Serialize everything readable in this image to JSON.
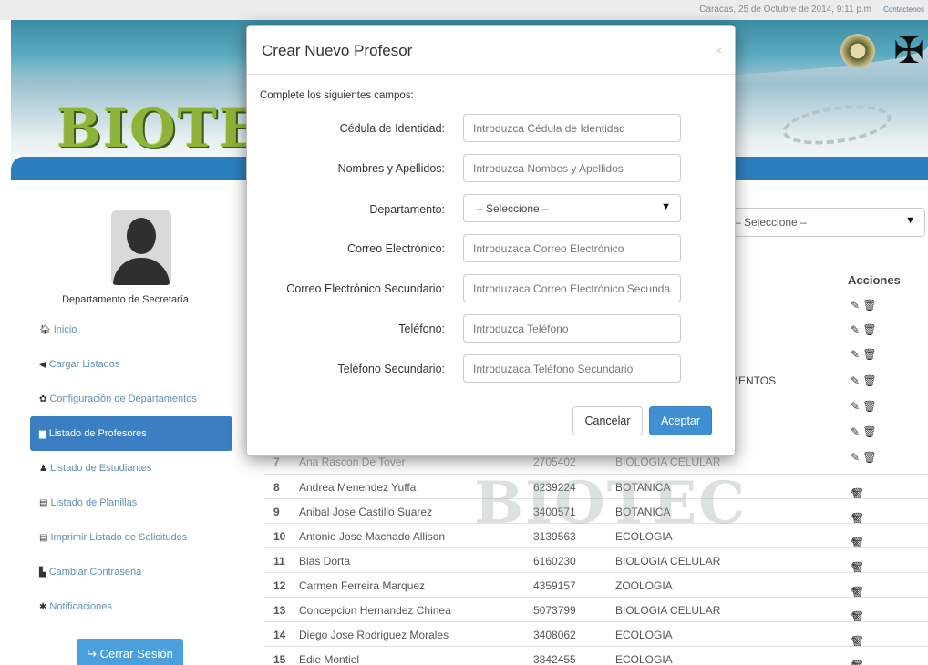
{
  "topbar": {
    "date": "Caracas, 25 de Octubre de 2014, 9:11 p.m",
    "contact": "Contactenos"
  },
  "banner": {
    "logo": "BIOTEC"
  },
  "sidebar": {
    "dept": "Departamento de Secretaría",
    "items": [
      {
        "label": "Inicio",
        "icon": "home-icon",
        "glyph": "🏠︎"
      },
      {
        "label": "Cargar Listados",
        "icon": "upload-icon",
        "glyph": "◀"
      },
      {
        "label": "Configuración de Departamentos",
        "icon": "gear-icon",
        "glyph": "✿"
      },
      {
        "label": "Listado de Profesores",
        "icon": "list-icon",
        "glyph": "▆"
      },
      {
        "label": "Listado de Estudiantes",
        "icon": "user-icon",
        "glyph": "♟"
      },
      {
        "label": "Listado de Planillas",
        "icon": "table-icon",
        "glyph": "▤"
      },
      {
        "label": "Imprimir Listado de Solicitudes",
        "icon": "print-list-icon",
        "glyph": "▤"
      },
      {
        "label": "Cambiar Contraseña",
        "icon": "lock-icon",
        "glyph": "▙"
      },
      {
        "label": "Notificaciones",
        "icon": "asterisk-icon",
        "glyph": "✱"
      }
    ],
    "logout": "Cerrar Sesión"
  },
  "content": {
    "select_value": "– Seleccione –",
    "acciones": "Acciones",
    "partial_dept": "MENTOS",
    "rows": [
      {
        "n": "7",
        "name": "Ana Rascon De Tover",
        "ci": "2705402",
        "dept": "BIOLOGIA CELULAR"
      },
      {
        "n": "8",
        "name": "Andrea Menendez Yuffa",
        "ci": "6239224",
        "dept": "BOTANICA"
      },
      {
        "n": "9",
        "name": "Anibal Jose Castillo Suarez",
        "ci": "3400571",
        "dept": "BOTANICA"
      },
      {
        "n": "10",
        "name": "Antonio Jose Machado Allison",
        "ci": "3139563",
        "dept": "ECOLOGIA"
      },
      {
        "n": "11",
        "name": "Blas Dorta",
        "ci": "6160230",
        "dept": "BIOLOGIA CELULAR"
      },
      {
        "n": "12",
        "name": "Carmen Ferreira Marquez",
        "ci": "4359157",
        "dept": "ZOOLOGIA"
      },
      {
        "n": "13",
        "name": "Concepcion Hernandez Chinea",
        "ci": "5073799",
        "dept": "BIOLOGIA CELULAR"
      },
      {
        "n": "14",
        "name": "Diego Jose Rodriguez Morales",
        "ci": "3408062",
        "dept": "ECOLOGIA"
      },
      {
        "n": "15",
        "name": "Edie Montiel",
        "ci": "3842455",
        "dept": "ECOLOGIA"
      }
    ]
  },
  "modal": {
    "title": "Crear Nuevo Profesor",
    "close": "×",
    "intro": "Complete los siguientes campos:",
    "fields": {
      "cedula": {
        "label": "Cédula de Identidad:",
        "placeholder": "Introduzca Cédula de Identidad"
      },
      "nombres": {
        "label": "Nombres y Apellidos:",
        "placeholder": "Introduzca Nombes y Apellidos"
      },
      "departamento": {
        "label": "Departamento:",
        "value": "– Seleccione –"
      },
      "correo": {
        "label": "Correo Electrónico:",
        "placeholder": "Introduzaca Correo Electrónico"
      },
      "correo2": {
        "label": "Correo Electrónico Secundario:",
        "placeholder": "Introduzaca Correo Electrónico Secundario"
      },
      "telefono": {
        "label": "Teléfono:",
        "placeholder": "Introduzca Teléfono"
      },
      "telefono2": {
        "label": "Teléfono Secundario:",
        "placeholder": "Introduzaca Teléfono Secundario"
      }
    },
    "cancel": "Cancelar",
    "accept": "Aceptar"
  },
  "colors": {
    "primary": "#3b7ec1",
    "accept": "#3f8fd2",
    "link": "#5f8fb7",
    "bluebar": "#2c7fbf"
  }
}
